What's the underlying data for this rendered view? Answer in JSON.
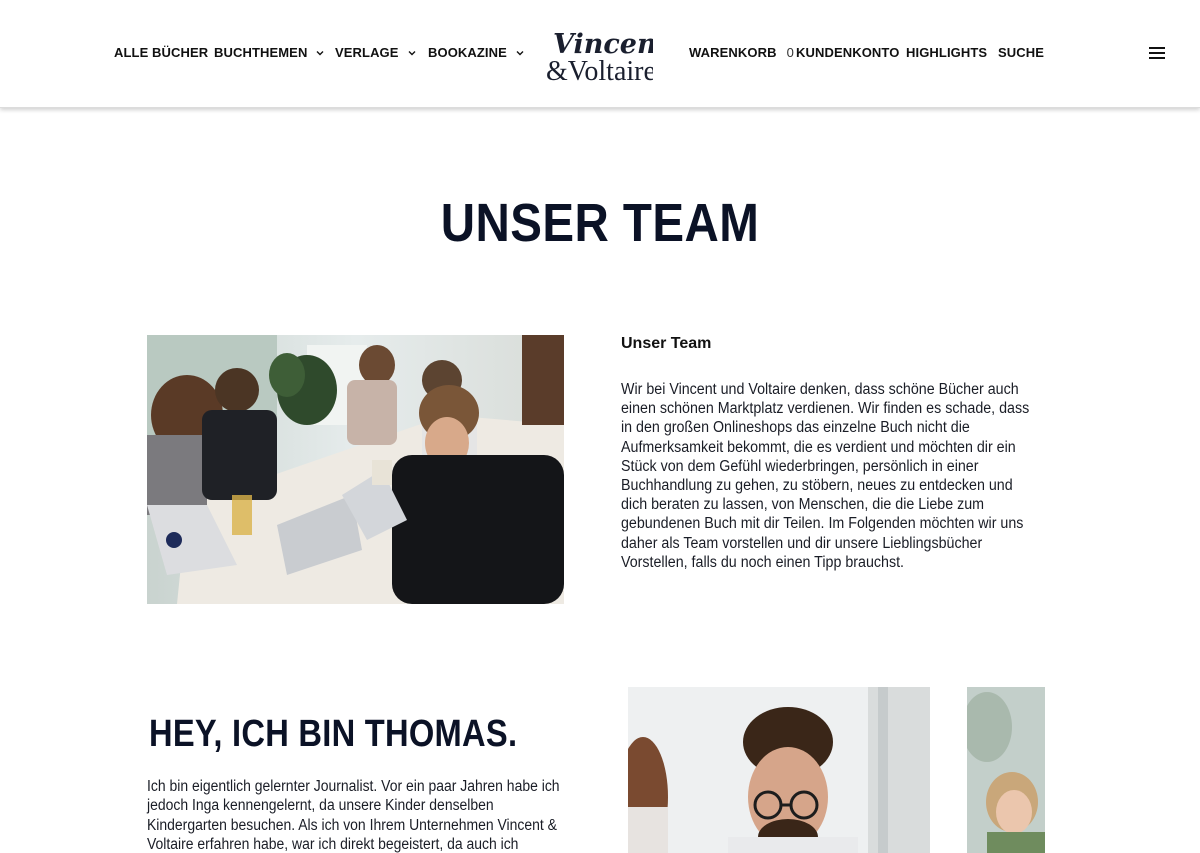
{
  "nav": {
    "left": [
      {
        "label": "ALLE BÜCHER",
        "has_dropdown": false
      },
      {
        "label": "BUCHTHEMEN",
        "has_dropdown": true
      },
      {
        "label": "VERLAGE",
        "has_dropdown": true
      },
      {
        "label": "BOOKAZINE",
        "has_dropdown": true
      }
    ],
    "cart_label": "WARENKORB",
    "cart_count": "0",
    "account_label": "KUNDENKONTO",
    "highlights_label": "HIGHLIGHTS",
    "search_label": "SUCHE",
    "menu_icon": "hamburger-icon"
  },
  "logo": {
    "line1": "Vincent",
    "line2": "&Voltaire"
  },
  "page": {
    "title": "UNSER TEAM"
  },
  "team": {
    "heading": "Unser Team",
    "text": "Wir bei Vincent und Voltaire denken, dass schöne Bücher auch einen schönen Marktplatz verdienen. Wir finden es schade, dass in den großen Onlineshops das einzelne Buch nicht die Aufmerksamkeit bekommt, die es verdient und möchten dir ein Stück von dem Gefühl wiederbringen, persönlich in einer Buchhandlung zu gehen, zu stöbern, neues zu entdecken und dich beraten zu lassen, von Menschen, die die Liebe zum gebundenen Buch mit dir Teilen. Im Folgenden möchten wir uns daher als Team vorstellen und dir unsere Lieblingsbücher Vorstellen, falls du noch einen Tipp brauchst."
  },
  "thomas": {
    "title": "HEY, ICH BIN THOMAS.",
    "text": "Ich bin eigentlich gelernter Journalist. Vor ein paar Jahren habe ich jedoch Inga kennengelernt, da unsere Kinder denselben Kindergarten besuchen. Als ich von Ihrem Unternehmen Vincent & Voltaire erfahren habe, war ich direkt begeistert, da auch ich"
  },
  "colors": {
    "text_dark": "#0b1226",
    "background": "#ffffff"
  }
}
